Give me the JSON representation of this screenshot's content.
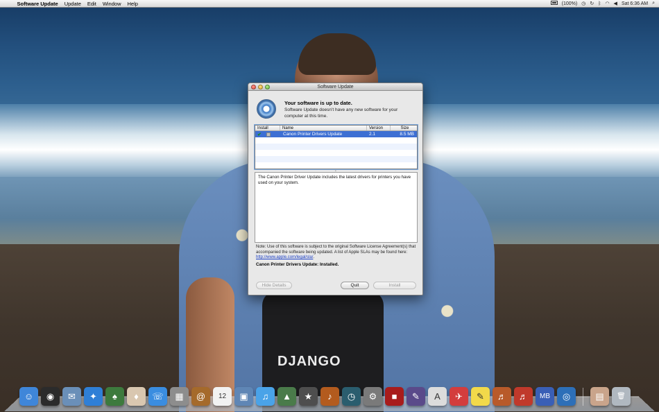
{
  "menubar": {
    "apple": "",
    "items": [
      "Software Update",
      "Update",
      "Edit",
      "Window",
      "Help"
    ],
    "battery": "(100%)",
    "clock": "Sat 6:36 AM"
  },
  "window": {
    "title": "Software Update",
    "heading": "Your software is up to date.",
    "subtext": "Software Update doesn’t have any new software for your computer at this time.",
    "table": {
      "columns": [
        "Install",
        "Name",
        "Version",
        "Size"
      ],
      "rows": [
        {
          "checked": "✔",
          "name": "Canon Printer Drivers Update",
          "version": "2.1",
          "size": "8.5 MB"
        }
      ]
    },
    "description": "The Canon Printer Driver Update includes the latest drivers for printers you have used on your system.",
    "note_text": "Note: Use of this software is subject to the original Software License Agreement(s) that accompanied the software being updated. A list of Apple SLAs may be found here:",
    "note_link": "http://www.apple.com/legal/sla/",
    "status": "Canon Printer Drivers Update: Installed.",
    "buttons": {
      "hide_details": "Hide Details",
      "quit": "Quit",
      "install": "Install"
    }
  },
  "wallpaper": {
    "shirt_text": "DJANGO"
  },
  "dock": {
    "icons": [
      {
        "name": "finder-icon",
        "color": "#3f86d9",
        "glyph": "☺"
      },
      {
        "name": "dashboard-icon",
        "color": "#2b2b2b",
        "glyph": "◉"
      },
      {
        "name": "mail-stamp-icon",
        "color": "#6a8fb8",
        "glyph": "✉"
      },
      {
        "name": "safari-icon",
        "color": "#2f7fd6",
        "glyph": "✦"
      },
      {
        "name": "solitaire-icon",
        "color": "#3d7a3d",
        "glyph": "♠"
      },
      {
        "name": "cards-icon",
        "color": "#d9c7b0",
        "glyph": "♦"
      },
      {
        "name": "ichat-icon",
        "color": "#3a8de0",
        "glyph": "☏"
      },
      {
        "name": "calculator-icon",
        "color": "#8d8d8d",
        "glyph": "▦"
      },
      {
        "name": "address-book-icon",
        "color": "#a56a2b",
        "glyph": "@"
      },
      {
        "name": "ical-icon",
        "color": "#f2f2f2",
        "glyph": "12"
      },
      {
        "name": "photo-viewer-icon",
        "color": "#5f86b5",
        "glyph": "▣"
      },
      {
        "name": "itunes-icon",
        "color": "#4aa3e8",
        "glyph": "♫"
      },
      {
        "name": "iphoto-icon",
        "color": "#4a7b4a",
        "glyph": "▲"
      },
      {
        "name": "imovie-star-icon",
        "color": "#4e4e4e",
        "glyph": "★"
      },
      {
        "name": "garageband-icon",
        "color": "#b35b1e",
        "glyph": "♪"
      },
      {
        "name": "time-machine-icon",
        "color": "#2a5d6e",
        "glyph": "◷"
      },
      {
        "name": "system-preferences-icon",
        "color": "#7a7a7a",
        "glyph": "⚙"
      },
      {
        "name": "photo-booth-icon",
        "color": "#a81c1c",
        "glyph": "■"
      },
      {
        "name": "paint-icon",
        "color": "#5a4a8a",
        "glyph": "✎"
      },
      {
        "name": "font-book-icon",
        "color": "#dcdcdc",
        "glyph": "A"
      },
      {
        "name": "hair-dryer-icon",
        "color": "#d33d3d",
        "glyph": "✈"
      },
      {
        "name": "stickies-icon",
        "color": "#f2d94a",
        "glyph": "✎"
      },
      {
        "name": "guitar-app-icon",
        "color": "#b85a2a",
        "glyph": "♬"
      },
      {
        "name": "guitar-app-2-icon",
        "color": "#c0392b",
        "glyph": "♬"
      },
      {
        "name": "mb-icon",
        "color": "#3a5fb6",
        "glyph": "MB"
      },
      {
        "name": "software-update-icon",
        "color": "#2d6fb8",
        "glyph": "◎"
      },
      {
        "name": "downloads-stack-icon",
        "color": "#c9a48b",
        "glyph": "▤"
      },
      {
        "name": "trash-icon",
        "color": "#b0b8c0",
        "glyph": "🗑"
      }
    ]
  }
}
